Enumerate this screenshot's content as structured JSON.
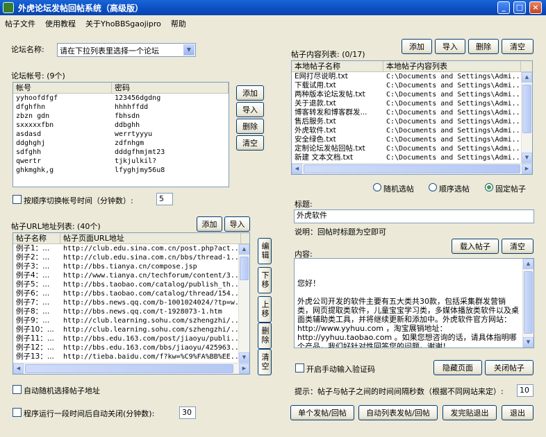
{
  "window": {
    "title": "外虎论坛发帖回帖系统（高级版）"
  },
  "menu": [
    "帖子文件",
    "使用教程",
    "关于YhoBBSgaojipro",
    "帮助"
  ],
  "forum": {
    "label": "论坛名称:",
    "select_value": "请在下拉列表里选择一个论坛"
  },
  "accounts": {
    "label": "论坛帐号: (9个)",
    "columns": [
      "帐号",
      "密码"
    ],
    "rows": [
      [
        "yyhoofdfgf",
        "123456dgdng"
      ],
      [
        "dfghfhn",
        "hhhhffdd"
      ],
      [
        "zbzn gdn",
        "fbhsdn"
      ],
      [
        "sxxxxxfbn",
        "ddbghh"
      ],
      [
        "asdasd",
        "werrtyyyu"
      ],
      [
        "ddghghj",
        "zdfnhgm"
      ],
      [
        "sdfghh",
        "dddgfhmjmt23"
      ],
      [
        "qwertr",
        "tjkjulkil?"
      ],
      [
        "ghkmghk,g",
        "lfyghjmy56u8"
      ]
    ],
    "buttons": {
      "add": "添加",
      "import": "导入",
      "delete": "删除",
      "clear": "清空"
    }
  },
  "switch": {
    "label": "按顺序切换帐号时间（分钟数）:",
    "value": "5"
  },
  "urls": {
    "label": "帖子URL地址列表: (40个)",
    "columns": [
      "帖子名称",
      "帖子页面URL地址"
    ],
    "rows": [
      [
        "例子1：...",
        "http://club.edu.sina.com.cn/post.php?act..."
      ],
      [
        "例子2：...",
        "http://club.edu.sina.com.cn/bbs/thread-1..."
      ],
      [
        "例子3：...",
        "http://bbs.tianya.cn/compose.jsp"
      ],
      [
        "例子4：...",
        "http://www.tianya.cn/techforum/content/3..."
      ],
      [
        "例子5：...",
        "http://bbs.taobao.com/catalog/publish_th..."
      ],
      [
        "例子6：...",
        "http://bbs.taobao.com/catalog/thread/154..."
      ],
      [
        "例子7：...",
        "http://bbs.news.qq.com/b-1001024024/?tp=w..."
      ],
      [
        "例子8：...",
        "http://bbs.news.qq.com/t-1928073-1.htm"
      ],
      [
        "例子9：...",
        "http://club.learning.sohu.com/szhengzhi/..."
      ],
      [
        "例子10：...",
        "http://club.learning.sohu.com/szhengzhi/..."
      ],
      [
        "例子11：...",
        "http://bbs.edu.163.com/post/jiaoyu/publi..."
      ],
      [
        "例子12：...",
        "http://bbs.edu.163.com/bbs/jiaoyu/425963..."
      ],
      [
        "例子13：...",
        "http://tieba.baidu.com/f?kw=%C9%FA%BB%EE..."
      ]
    ],
    "buttons": {
      "add": "添加",
      "import": "导入",
      "edit": "编辑",
      "down": "下移",
      "up": "上移",
      "delete": "删除",
      "clear": "清空"
    }
  },
  "auto_random": {
    "label": "自动随机选择帖子地址"
  },
  "auto_close": {
    "label": "程序运行一段时间后自动关闭(分钟数):",
    "value": "30"
  },
  "contents": {
    "label": "帖子内容列表: (0/17)",
    "columns": [
      "本地帖子名称",
      "本地帖子内容列表"
    ],
    "rows": [
      [
        "E网打尽说明.txt",
        "C:\\Documents and Settings\\Admi..."
      ],
      [
        "下载试用.txt",
        "C:\\Documents and Settings\\Admi..."
      ],
      [
        "两种版本论坛发帖.txt",
        "C:\\Documents and Settings\\Admi..."
      ],
      [
        "关于退款.txt",
        "C:\\Documents and Settings\\Admi..."
      ],
      [
        "博客转发和博客群发...",
        "C:\\Documents and Settings\\Admi..."
      ],
      [
        "售后服务.txt",
        "C:\\Documents and Settings\\Admi..."
      ],
      [
        "外虎软件.txt",
        "C:\\Documents and Settings\\Admi..."
      ],
      [
        "安全绿色.txt",
        "C:\\Documents and Settings\\Admi..."
      ],
      [
        "定制论坛发帖回帖.txt",
        "C:\\Documents and Settings\\Admi..."
      ],
      [
        "新建 文本文档.txt",
        "C:\\Documents and Settings\\Admi..."
      ]
    ],
    "buttons": {
      "add": "添加",
      "import": "导入",
      "delete": "删除",
      "clear": "清空"
    }
  },
  "mode": {
    "options": [
      "随机选帖",
      "顺序选帖",
      "固定帖子"
    ],
    "selected": "固定帖子"
  },
  "title_field": {
    "label": "标题:",
    "value": "外虎软件",
    "note": "说明：回帖时标题为空即可"
  },
  "content_field": {
    "label": "内容:",
    "load_button": "载入帖子",
    "clear_button": "清空",
    "value": "您好！\n\n外虎公司开发的软件主要有五大类共30款，包括采集群发营销类，网页提取类软件，儿童宝宝学习类，多媒体播放类软件以及桌面类辅助类工具，并将继续更新和添加中。外虎软件官方网站： http://www.yyhuu.com ，淘宝展销地址：http://yyhuu.taobao.com 。如果您想咨询的话，请具体指明哪个产品，我们好针对性回答您的问题。谢谢！\n\n联系方式"
  },
  "captcha": {
    "label": "开启手动输入验证码"
  },
  "hide_button": "隐藏页面",
  "close_button": "关闭帖子",
  "interval": {
    "label": "提示：帖子与帖子之间的时间间隔秒数（根据不同网站来定）:",
    "value": "10"
  },
  "bottom_buttons": {
    "single": "单个发帖/回帖",
    "auto": "自动列表发帖/回帖",
    "exit_post": "发完贴退出",
    "exit": "退出"
  }
}
